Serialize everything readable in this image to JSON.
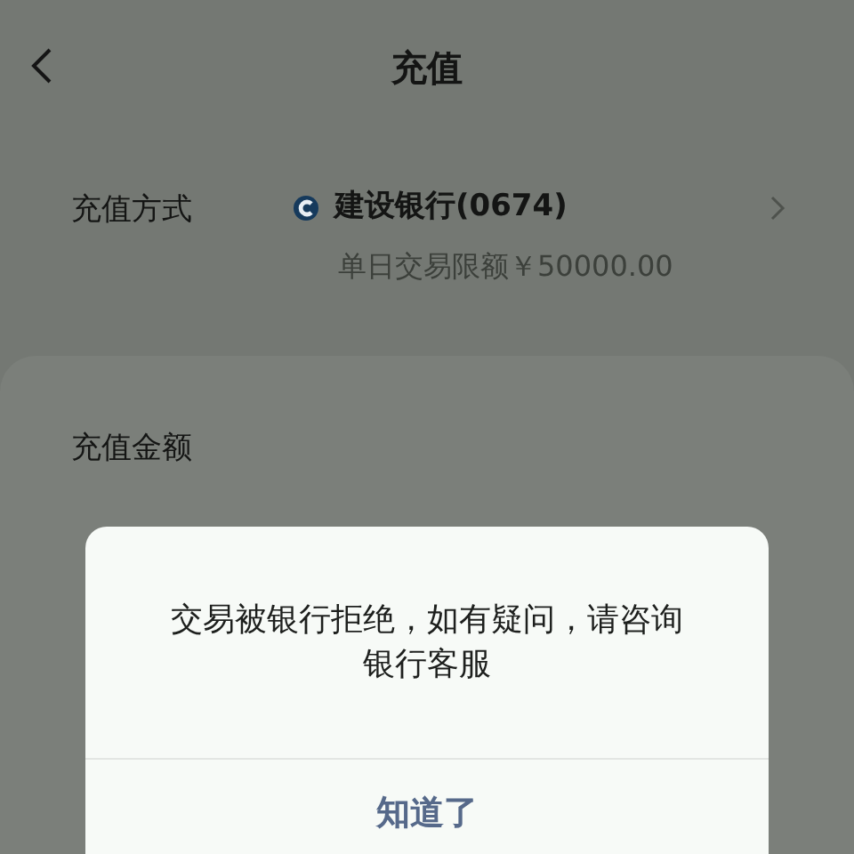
{
  "header": {
    "title": "充值"
  },
  "payment_method": {
    "label": "充值方式",
    "bank": "建设银行(0674)",
    "limit": "单日交易限额￥50000.00"
  },
  "amount_card": {
    "label": "充值金额"
  },
  "dialog": {
    "message": "交易被银行拒绝，如有疑问，请咨询银行客服",
    "button": "知道了"
  }
}
